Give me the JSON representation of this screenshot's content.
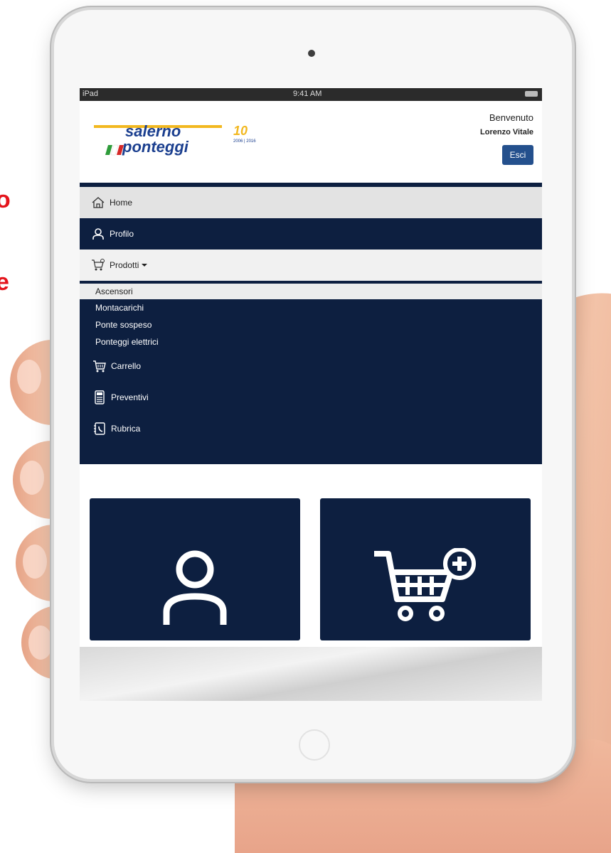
{
  "side_text": [
    "o",
    "e"
  ],
  "statusbar": {
    "device": "iPad",
    "time": "9:41 AM"
  },
  "header": {
    "welcome": "Benvenuto",
    "user": "Lorenzo Vitale",
    "logout_label": "Esci"
  },
  "logo": {
    "line1": "salerno",
    "line2": "ponteggi",
    "badge": "10",
    "years": "2006 | 2016"
  },
  "nav": {
    "home": "Home",
    "profilo": "Profilo",
    "prodotti": "Prodotti"
  },
  "submenu": {
    "items": [
      "Ascensori",
      "Montacarichi",
      "Ponte sospeso",
      "Ponteggi elettrici"
    ],
    "carrello": "Carrello",
    "preventivi": "Preventivi",
    "rubrica": "Rubrica"
  },
  "colors": {
    "navy": "#0d1f40",
    "button_blue": "#24508d",
    "brand_blue": "#1b3f8f",
    "brand_yellow": "#f2b820",
    "highlight_red": "#e4141c"
  }
}
